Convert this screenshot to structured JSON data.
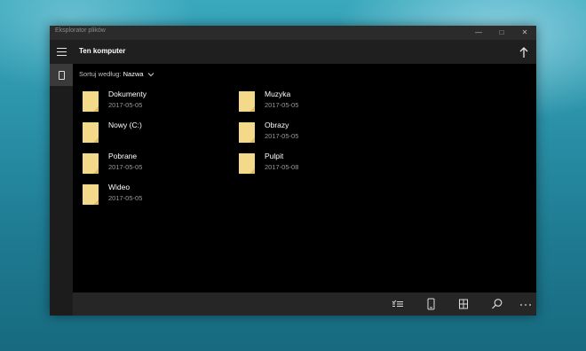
{
  "window": {
    "title": "Eksplorator plików"
  },
  "header": {
    "location": "Ten komputer"
  },
  "sort": {
    "label": "Sortuj według:",
    "value": "Nazwa"
  },
  "items": [
    {
      "name": "Dokumenty",
      "date": "2017-05-05"
    },
    {
      "name": "Muzyka",
      "date": "2017-05-05"
    },
    {
      "name": "Nowy (C:)",
      "date": ""
    },
    {
      "name": "Obrazy",
      "date": "2017-05-05"
    },
    {
      "name": "Pobrane",
      "date": "2017-05-05"
    },
    {
      "name": "Pulpit",
      "date": "2017-05-08"
    },
    {
      "name": "Wideo",
      "date": "2017-05-05"
    }
  ],
  "colors": {
    "folder": "#f5d98a",
    "folder_dark": "#e2bd61",
    "window_bg": "#000000"
  }
}
